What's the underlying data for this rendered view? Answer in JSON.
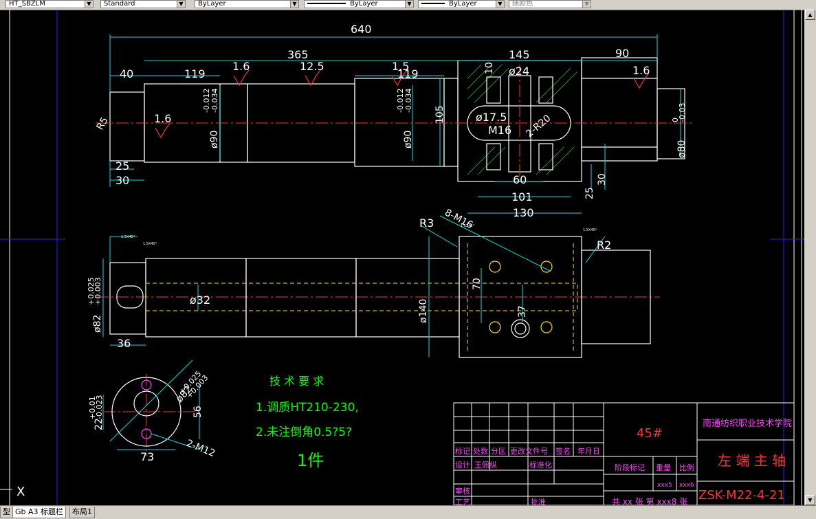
{
  "toolbar": {
    "text_style": "HT_SBZLM",
    "dim_style": "Standard",
    "layer": "ByLayer",
    "linetype": "ByLayer",
    "lineweight": "ByLayer",
    "color": "随颜色"
  },
  "tabs": [
    "型",
    "Gb A3 标题栏",
    "布局1"
  ],
  "ucs_label": "X",
  "dims": {
    "d640": "640",
    "d365": "365",
    "d145": "145",
    "d90": "90",
    "d40": "40",
    "d119a": "119",
    "d119b": "119",
    "r16a": "1.6",
    "r125": "12.5",
    "r15": "1.5",
    "r16b": "1.6",
    "r16c": "1.6",
    "d10": "10",
    "d24": "ø24",
    "d175": "ø17.5",
    "m16": "M16",
    "r20": "2-R20",
    "d105": "105",
    "tolA": "-0.012",
    "tolB": "-0.034",
    "d90a": "ø90",
    "tolC": "-0.012",
    "tolD": "-0.034",
    "d90b": "ø90",
    "tolE": "0",
    "tolF": "-0.03",
    "d80": "ø80",
    "r5": "R5",
    "d25": "25",
    "d30": "30",
    "d60": "60",
    "d101": "101",
    "d130": "130",
    "d25b": "25",
    "d30b": "30",
    "r3": "R3",
    "m16b": "8-M16",
    "r2": "R2",
    "d32": "ø32",
    "d140": "ø140",
    "d70": "70",
    "d37": "37",
    "d36": "36",
    "tolG": "+0.025",
    "tolH": "+0.003",
    "d82": "ø82",
    "tolI": "+0.025",
    "tolJ": "+0.003",
    "d82b": "ø82",
    "tolK": "+0.01",
    "tolL": "-0.023",
    "d22": "22",
    "d56": "56",
    "d73": "73",
    "m12": "2-M12",
    "rough": "1.5X45°"
  },
  "notes": {
    "title": "技 术 要 求",
    "line1": "1.调质HT210-230,",
    "line2": "2.未注倒角0.5?5?",
    "count": "1件"
  },
  "title_block": {
    "material": "45#",
    "school": "南通纺织职业技术学院",
    "part_name": "左 端 主 轴",
    "drawing_no": "ZSK-M22-4-21",
    "h1": "标记",
    "h2": "处数",
    "h3": "分区",
    "h4": "更改文件号",
    "h5": "签名",
    "h6": "年月日",
    "r1a": "设计",
    "r1b": "王佩纵",
    "r1c": "标准化",
    "r2a": "审核",
    "r3a": "工艺",
    "r3b": "批准",
    "stage": "阶段标记",
    "weight": "重量",
    "scale": "比例",
    "w_val": "xxx5",
    "s_val": "xxx6",
    "sheets": "共 xx 张 第 xxx8 张"
  }
}
